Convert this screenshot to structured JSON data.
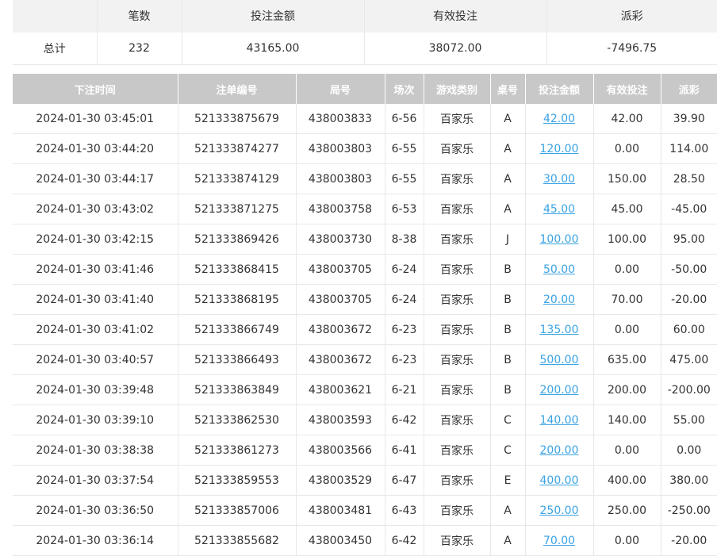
{
  "summary": {
    "headers": [
      "",
      "笔数",
      "投注金额",
      "有效投注",
      "派彩"
    ],
    "row_label": "总计",
    "count": "232",
    "bet_amount": "43165.00",
    "valid_bet": "38072.00",
    "payout": "-7496.75"
  },
  "detail": {
    "headers": [
      "下注时间",
      "注单编号",
      "局号",
      "场次",
      "游戏类别",
      "桌号",
      "投注金额",
      "有效投注",
      "派彩"
    ],
    "rows": [
      {
        "time": "2024-01-30 03:45:01",
        "order": "521333875679",
        "round": "438003833",
        "session": "6-56",
        "game": "百家乐",
        "table": "A",
        "bet": "42.00",
        "valid": "42.00",
        "payout": "39.90"
      },
      {
        "time": "2024-01-30 03:44:20",
        "order": "521333874277",
        "round": "438003803",
        "session": "6-55",
        "game": "百家乐",
        "table": "A",
        "bet": "120.00",
        "valid": "0.00",
        "payout": "114.00"
      },
      {
        "time": "2024-01-30 03:44:17",
        "order": "521333874129",
        "round": "438003803",
        "session": "6-55",
        "game": "百家乐",
        "table": "A",
        "bet": "30.00",
        "valid": "150.00",
        "payout": "28.50"
      },
      {
        "time": "2024-01-30 03:43:02",
        "order": "521333871275",
        "round": "438003758",
        "session": "6-53",
        "game": "百家乐",
        "table": "A",
        "bet": "45.00",
        "valid": "45.00",
        "payout": "-45.00"
      },
      {
        "time": "2024-01-30 03:42:15",
        "order": "521333869426",
        "round": "438003730",
        "session": "8-38",
        "game": "百家乐",
        "table": "J",
        "bet": "100.00",
        "valid": "100.00",
        "payout": "95.00"
      },
      {
        "time": "2024-01-30 03:41:46",
        "order": "521333868415",
        "round": "438003705",
        "session": "6-24",
        "game": "百家乐",
        "table": "B",
        "bet": "50.00",
        "valid": "0.00",
        "payout": "-50.00"
      },
      {
        "time": "2024-01-30 03:41:40",
        "order": "521333868195",
        "round": "438003705",
        "session": "6-24",
        "game": "百家乐",
        "table": "B",
        "bet": "20.00",
        "valid": "70.00",
        "payout": "-20.00"
      },
      {
        "time": "2024-01-30 03:41:02",
        "order": "521333866749",
        "round": "438003672",
        "session": "6-23",
        "game": "百家乐",
        "table": "B",
        "bet": "135.00",
        "valid": "0.00",
        "payout": "60.00"
      },
      {
        "time": "2024-01-30 03:40:57",
        "order": "521333866493",
        "round": "438003672",
        "session": "6-23",
        "game": "百家乐",
        "table": "B",
        "bet": "500.00",
        "valid": "635.00",
        "payout": "475.00"
      },
      {
        "time": "2024-01-30 03:39:48",
        "order": "521333863849",
        "round": "438003621",
        "session": "6-21",
        "game": "百家乐",
        "table": "B",
        "bet": "200.00",
        "valid": "200.00",
        "payout": "-200.00"
      },
      {
        "time": "2024-01-30 03:39:10",
        "order": "521333862530",
        "round": "438003593",
        "session": "6-42",
        "game": "百家乐",
        "table": "C",
        "bet": "140.00",
        "valid": "140.00",
        "payout": "55.00"
      },
      {
        "time": "2024-01-30 03:38:38",
        "order": "521333861273",
        "round": "438003566",
        "session": "6-41",
        "game": "百家乐",
        "table": "C",
        "bet": "200.00",
        "valid": "0.00",
        "payout": "0.00"
      },
      {
        "time": "2024-01-30 03:37:54",
        "order": "521333859553",
        "round": "438003529",
        "session": "6-47",
        "game": "百家乐",
        "table": "E",
        "bet": "400.00",
        "valid": "400.00",
        "payout": "380.00"
      },
      {
        "time": "2024-01-30 03:36:50",
        "order": "521333857006",
        "round": "438003481",
        "session": "6-43",
        "game": "百家乐",
        "table": "A",
        "bet": "250.00",
        "valid": "250.00",
        "payout": "-250.00"
      },
      {
        "time": "2024-01-30 03:36:14",
        "order": "521333855682",
        "round": "438003450",
        "session": "6-42",
        "game": "百家乐",
        "table": "A",
        "bet": "70.00",
        "valid": "0.00",
        "payout": "-20.00"
      }
    ]
  },
  "colors": {
    "negative": "#e8505b",
    "link": "#3aa3e3",
    "header_bg": "#c8c8c8"
  }
}
